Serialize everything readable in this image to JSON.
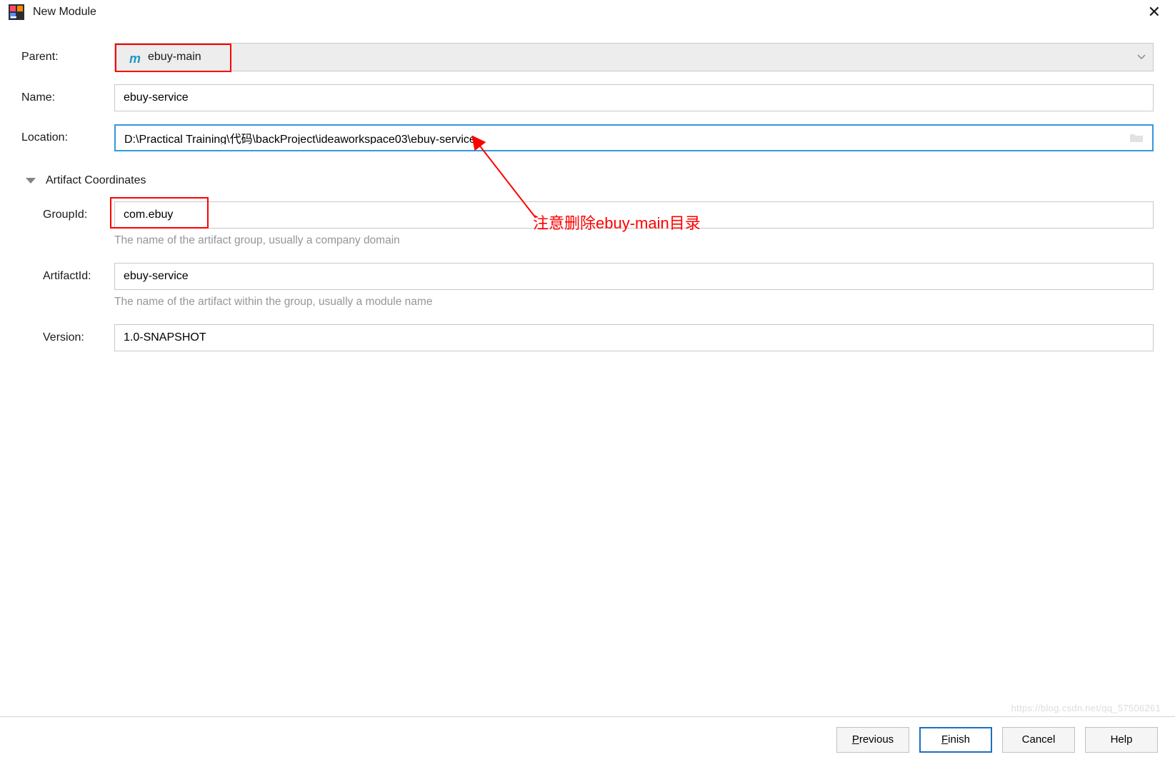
{
  "window": {
    "title": "New Module"
  },
  "form": {
    "parent_label": "Parent:",
    "parent_value": "ebuy-main",
    "name_label": "Name:",
    "name_value": "ebuy-service",
    "location_label": "Location:",
    "location_value": "D:\\Practical Training\\代码\\backProject\\ideaworkspace03\\ebuy-service"
  },
  "artifact": {
    "section_title": "Artifact Coordinates",
    "groupid_label": "GroupId:",
    "groupid_value": "com.ebuy",
    "groupid_help": "The name of the artifact group, usually a company domain",
    "artifactid_label": "ArtifactId:",
    "artifactid_value": "ebuy-service",
    "artifactid_help": "The name of the artifact within the group, usually a module name",
    "version_label": "Version:",
    "version_value": "1.0-SNAPSHOT"
  },
  "annotation": {
    "note": "注意删除ebuy-main目录"
  },
  "buttons": {
    "previous": "Previous",
    "finish": "Finish",
    "cancel": "Cancel",
    "help": "Help"
  },
  "watermark": "https://blog.csdn.net/qq_57506261"
}
